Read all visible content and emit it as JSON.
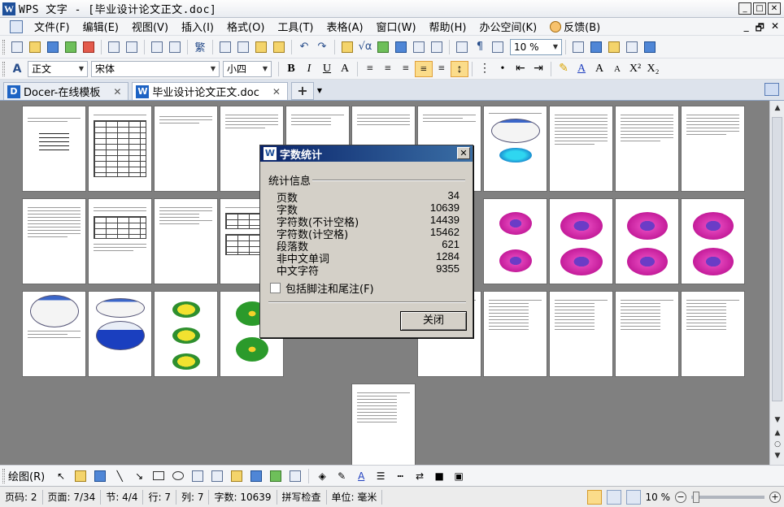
{
  "window": {
    "title": "WPS 文字 - [毕业设计论文正文.doc]",
    "controls": [
      "_",
      "□",
      "✕"
    ]
  },
  "menubar": {
    "items": [
      "文件(F)",
      "编辑(E)",
      "视图(V)",
      "插入(I)",
      "格式(O)",
      "工具(T)",
      "表格(A)",
      "窗口(W)",
      "帮助(H)",
      "办公空间(K)",
      "反馈(B)"
    ],
    "right": [
      "_",
      "🗗",
      "✕"
    ]
  },
  "toolbar": {
    "zoom": "10 %",
    "traditional": "繁"
  },
  "format_bar": {
    "style": "正文",
    "font": "宋体",
    "size": "小四"
  },
  "tabs": [
    {
      "label": "Docer-在线模板",
      "close": "✕"
    },
    {
      "label": "毕业设计论文正文.doc",
      "close": "✕"
    }
  ],
  "dialog": {
    "title": "字数统计",
    "group_label": "统计信息",
    "stats": [
      {
        "label": "页数",
        "value": "34"
      },
      {
        "label": "字数",
        "value": "10639"
      },
      {
        "label": "字符数(不计空格)",
        "value": "14439"
      },
      {
        "label": "字符数(计空格)",
        "value": "15462"
      },
      {
        "label": "段落数",
        "value": "621"
      },
      {
        "label": "非中文单词",
        "value": "1284"
      },
      {
        "label": "中文字符",
        "value": "9355"
      }
    ],
    "checkbox_label": "包括脚注和尾注(F)",
    "close_button": "关闭",
    "close_x": "✕"
  },
  "drawbar": {
    "label": "绘图(R)"
  },
  "statusbar": {
    "page_code": "页码: 2",
    "page": "页面: 7/34",
    "section": "节: 4/4",
    "row": "行: 7",
    "col": "列: 7",
    "word_count": "字数: 10639",
    "spell": "拼写检查",
    "unit": "单位: 毫米",
    "zoom": "10 %",
    "minus": "−",
    "plus": "+"
  }
}
